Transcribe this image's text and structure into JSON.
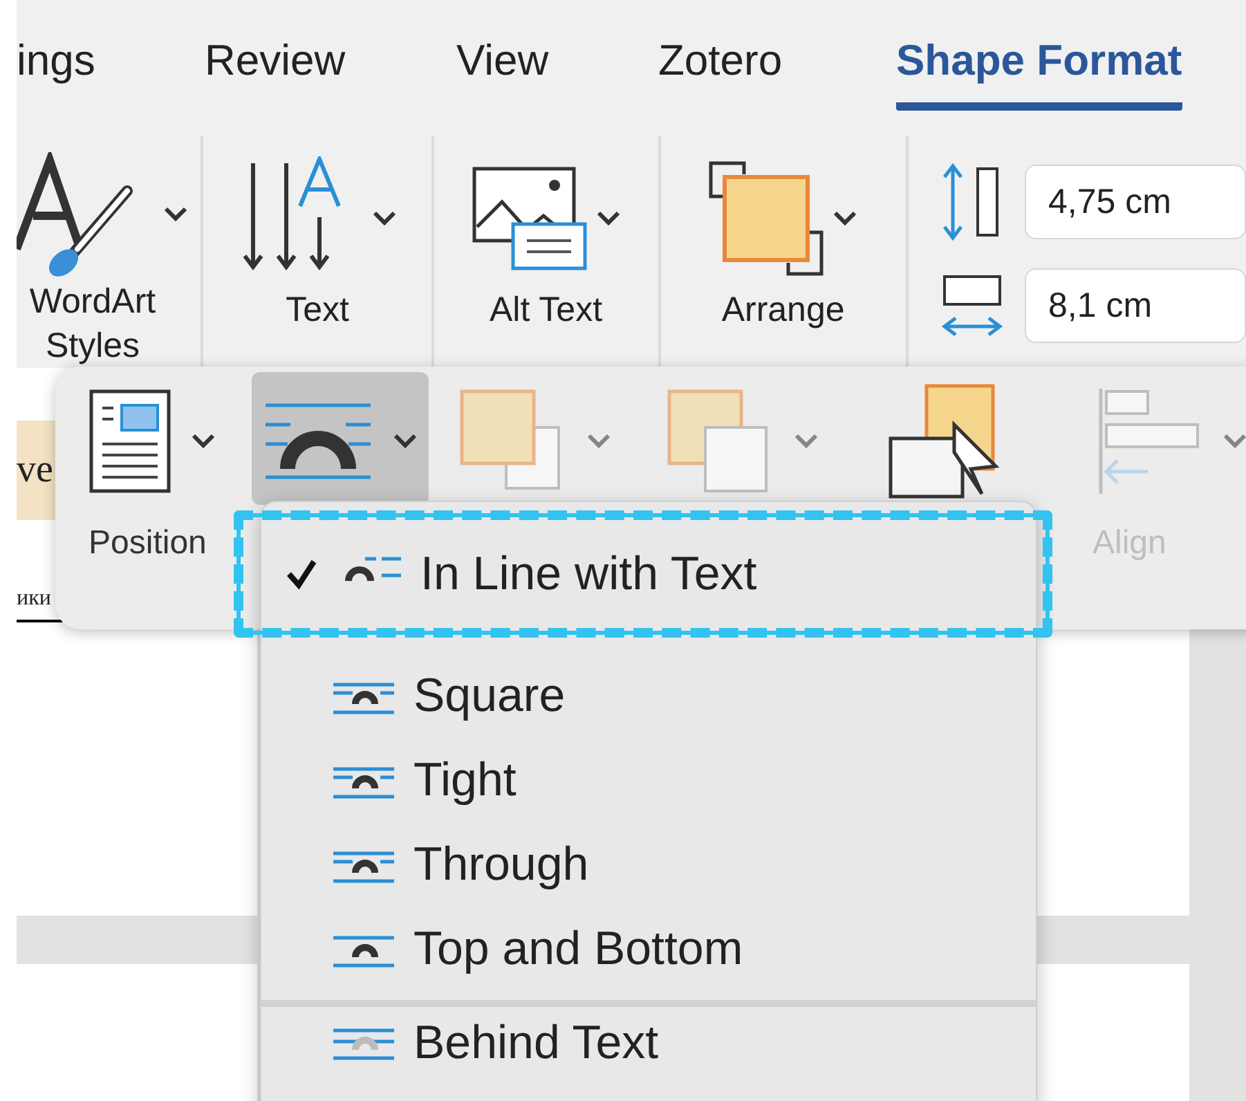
{
  "tabs": [
    {
      "label": "ings",
      "selected": false
    },
    {
      "label": "Review",
      "selected": false
    },
    {
      "label": "View",
      "selected": false
    },
    {
      "label": "Zotero",
      "selected": false
    },
    {
      "label": "Shape Format",
      "selected": true
    }
  ],
  "ribbon": {
    "groups": [
      {
        "kind": "wordart",
        "label": "WordArt Styles"
      },
      {
        "kind": "textdir",
        "label": "Text"
      },
      {
        "kind": "alttext",
        "label": "Alt Text"
      },
      {
        "kind": "arrange",
        "label": "Arrange"
      }
    ],
    "size_fields": [
      {
        "kind": "height",
        "value": "4,75 cm"
      },
      {
        "kind": "width",
        "value": "8,1 cm"
      }
    ]
  },
  "document": {
    "fragments": [
      "ve",
      "ики"
    ]
  },
  "arrange_panel": {
    "buttons": [
      {
        "kind": "position",
        "label": "Position",
        "disabled": false,
        "selected": false
      },
      {
        "kind": "wrap",
        "disabled": false,
        "selected": true
      },
      {
        "kind": "forward",
        "disabled": true,
        "selected": false
      },
      {
        "kind": "backward",
        "disabled": true,
        "selected": false
      },
      {
        "kind": "pane",
        "disabled": false,
        "selected": false
      },
      {
        "kind": "align",
        "label": "Align",
        "disabled": true,
        "selected": false
      }
    ]
  },
  "wrap_menu": {
    "items": [
      {
        "kind": "inline",
        "label": "In Line with Text",
        "checked": true,
        "highlighted": true,
        "separator_before": false
      },
      {
        "kind": "square",
        "label": "Square",
        "checked": false,
        "highlighted": false,
        "separator_before": false
      },
      {
        "kind": "tight",
        "label": "Tight",
        "checked": false,
        "highlighted": false,
        "separator_before": false
      },
      {
        "kind": "through",
        "label": "Through",
        "checked": false,
        "highlighted": false,
        "separator_before": false
      },
      {
        "kind": "topbottom",
        "label": "Top and Bottom",
        "checked": false,
        "highlighted": false,
        "separator_before": false
      },
      {
        "kind": "behind",
        "label": "Behind Text",
        "checked": false,
        "highlighted": false,
        "separator_before": true
      }
    ]
  }
}
